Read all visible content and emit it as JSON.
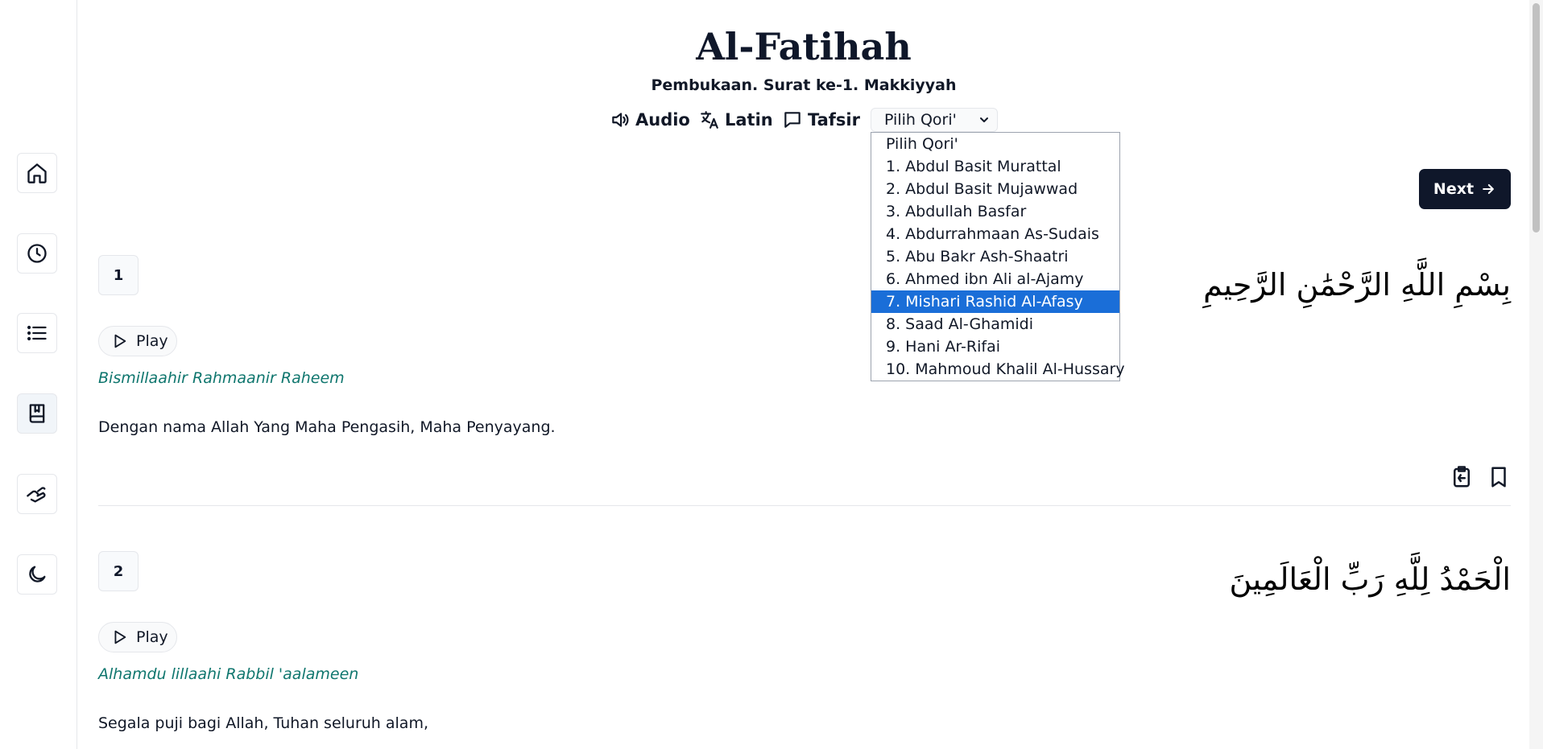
{
  "header": {
    "title": "Al-Fatihah",
    "subtitle": "Pembukaan. Surat ke-1. Makkiyyah"
  },
  "toolbar": {
    "audio_label": "Audio",
    "latin_label": "Latin",
    "tafsir_label": "Tafsir",
    "qori_selected": "Pilih Qori'"
  },
  "qori_options": [
    "Pilih Qori'",
    "1. Abdul Basit Murattal",
    "2. Abdul Basit Mujawwad",
    "3. Abdullah Basfar",
    "4. Abdurrahmaan As-Sudais",
    "5. Abu Bakr Ash-Shaatri",
    "6. Ahmed ibn Ali al-Ajamy",
    "7. Mishari Rashid Al-Afasy",
    "8. Saad Al-Ghamidi",
    "9. Hani Ar-Rifai",
    "10. Mahmoud Khalil Al-Hussary"
  ],
  "highlighted_option_index": 7,
  "nav": {
    "next_label": "Next"
  },
  "verses": [
    {
      "number": "1",
      "arabic": "بِسْمِ اللَّهِ الرَّحْمَٰنِ الرَّحِيمِ",
      "play_label": "Play",
      "latin": "Bismillaahir Rahmaanir Raheem",
      "translation": "Dengan nama Allah Yang Maha Pengasih, Maha Penyayang."
    },
    {
      "number": "2",
      "arabic": "الْحَمْدُ لِلَّهِ رَبِّ الْعَالَمِينَ",
      "play_label": "Play",
      "latin": "Alhamdu lillaahi Rabbil 'aalameen",
      "translation": "Segala puji bagi Allah, Tuhan seluruh alam,"
    }
  ],
  "icons": {
    "sidebar": [
      "home-icon",
      "history-icon",
      "list-icon",
      "book-icon",
      "hand-icon",
      "moon-icon"
    ],
    "toolbar": [
      "speaker-icon",
      "translate-icon",
      "chat-icon",
      "chevron-down-icon"
    ],
    "actions": [
      "clipboard-icon",
      "bookmark-icon"
    ]
  },
  "colors": {
    "primary_dark": "#0f172a",
    "latin_text": "#0f766e",
    "selection": "#1a6ed8",
    "border": "#e5e7eb"
  }
}
